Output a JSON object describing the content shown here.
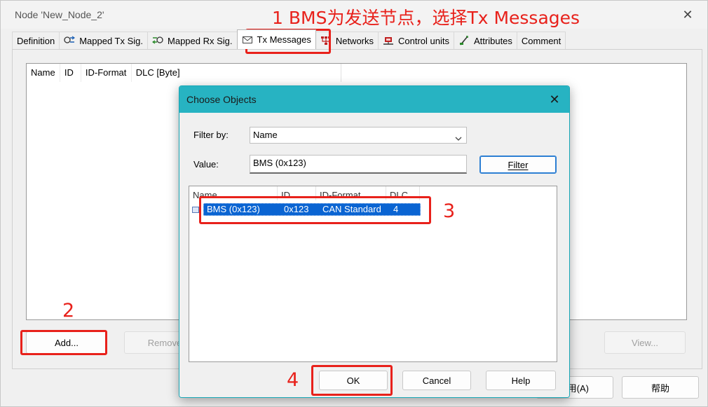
{
  "window": {
    "title": "Node 'New_Node_2'",
    "close_glyph": "✕"
  },
  "tabs": [
    {
      "label": "Definition",
      "icon": ""
    },
    {
      "label": "Mapped Tx Sig.",
      "icon": "mapped-tx-icon"
    },
    {
      "label": "Mapped Rx Sig.",
      "icon": "mapped-rx-icon"
    },
    {
      "label": "Tx Messages",
      "icon": "envelope-icon",
      "active": true
    },
    {
      "label": "Networks",
      "icon": "network-icon"
    },
    {
      "label": "Control units",
      "icon": "control-unit-icon"
    },
    {
      "label": "Attributes",
      "icon": "attributes-icon"
    },
    {
      "label": "Comment",
      "icon": ""
    }
  ],
  "main_list": {
    "columns": [
      "Name",
      "ID",
      "ID-Format",
      "DLC [Byte]"
    ]
  },
  "main_buttons": {
    "add": "Add...",
    "remove": "Remove",
    "view": "View...",
    "apply": "用(A)",
    "help": "帮助"
  },
  "dialog": {
    "title": "Choose Objects",
    "close_glyph": "✕",
    "filter_by_label": "Filter by:",
    "filter_by_value": "Name",
    "value_label": "Value:",
    "value_input": "BMS (0x123)",
    "filter_button": "Filter",
    "columns": [
      "Name",
      "ID",
      "ID-Format",
      "DLC ..."
    ],
    "rows": [
      {
        "name": "BMS (0x123)",
        "id": "0x123",
        "id_format": "CAN Standard",
        "dlc": "4",
        "selected": true
      }
    ],
    "ok": "OK",
    "cancel": "Cancel",
    "help": "Help"
  },
  "annotations": {
    "step1": "1 BMS为发送节点，选择Tx Messages",
    "step2": "2",
    "step3": "3",
    "step4": "4",
    "color": "#e8211b"
  },
  "colors": {
    "dialog_title": "#27b3c2",
    "selection": "#0a64d2",
    "focus_border": "#2d7fd3"
  }
}
